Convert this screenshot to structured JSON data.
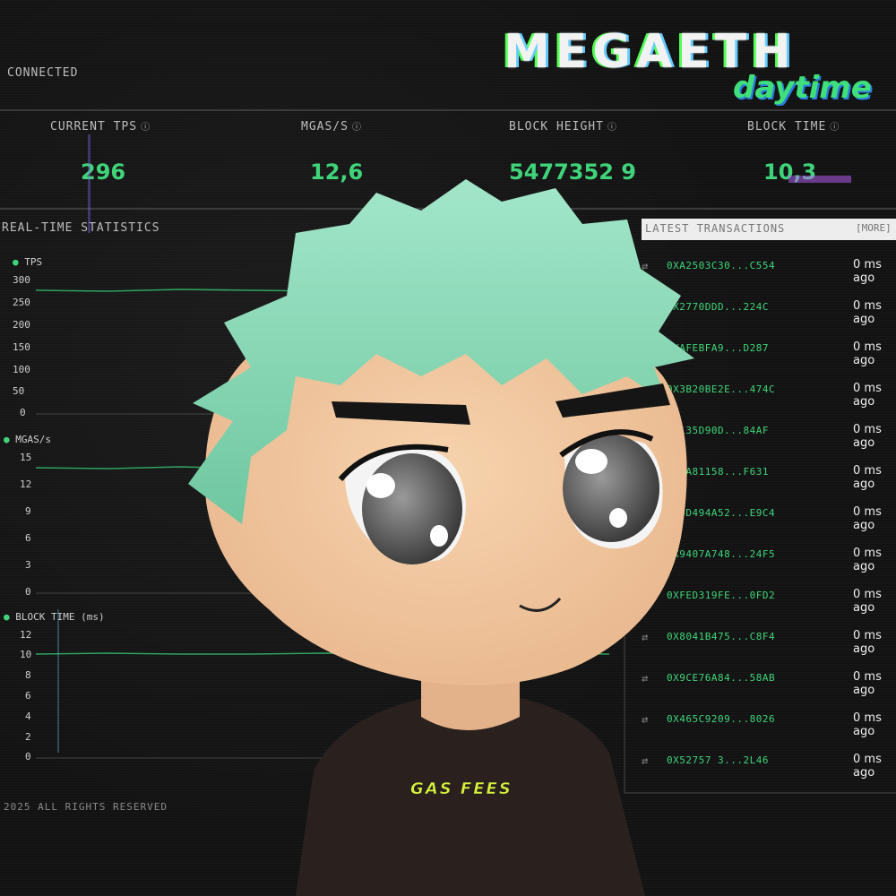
{
  "header": {
    "status": "CONNECTED",
    "logo": {
      "main": "MEGAETH",
      "sub": "daytime"
    }
  },
  "stats": [
    {
      "label": "CURRENT TPS",
      "value": "296"
    },
    {
      "label": "MGAS/S",
      "value": "12,6"
    },
    {
      "label": "BLOCK HEIGHT",
      "value": "5477352 9"
    },
    {
      "label": "BLOCK TIME",
      "value": "10,3"
    }
  ],
  "realtime": {
    "title": "REAL-TIME STATISTICS",
    "charts": [
      {
        "name": "TPS",
        "ticks": [
          "300",
          "250",
          "200",
          "150",
          "100",
          "50",
          "0"
        ]
      },
      {
        "name": "MGAS/s",
        "ticks": [
          "15",
          "12",
          "9",
          "6",
          "3",
          "0"
        ]
      },
      {
        "name": "BLOCK TIME (ms)",
        "ticks": [
          "12",
          "10",
          "8",
          "6",
          "4",
          "2",
          "0"
        ]
      }
    ]
  },
  "transactions": {
    "title": "LATEST TRANSACTIONS",
    "more": "[MORE]",
    "rows": [
      {
        "hash": "0XA2503C30...C554",
        "time": "0 ms ago"
      },
      {
        "hash": "0X2770DDD...224C",
        "time": "0 ms ago"
      },
      {
        "hash": "0XAFEBFA9...D287",
        "time": "0 ms ago"
      },
      {
        "hash": "0X3B20BE2E...474C",
        "time": "0 ms ago"
      },
      {
        "hash": "0X135D90D...84AF",
        "time": "0 ms ago"
      },
      {
        "hash": "0XFA81158...F631",
        "time": "0 ms ago"
      },
      {
        "hash": "0X4D494A52...E9C4",
        "time": "0 ms ago"
      },
      {
        "hash": "0X9407A748...24F5",
        "time": "0 ms ago"
      },
      {
        "hash": "0XFED319FE...0FD2",
        "time": "0 ms ago"
      },
      {
        "hash": "0X8041B475...C8F4",
        "time": "0 ms ago"
      },
      {
        "hash": "0X9CE76A84...58AB",
        "time": "0 ms ago"
      },
      {
        "hash": "0X465C9209...8026",
        "time": "0 ms ago"
      },
      {
        "hash": "0X52757 3...2L46",
        "time": "0 ms ago"
      }
    ]
  },
  "footer": "2025 ALL RIGHTS RESERVED",
  "character": {
    "shirt_text": "GAS FEES"
  },
  "colors": {
    "accent": "#3fd47a",
    "hair": "#8fd9b6",
    "skin": "#f0c9a0",
    "shirt": "#2a211f"
  }
}
